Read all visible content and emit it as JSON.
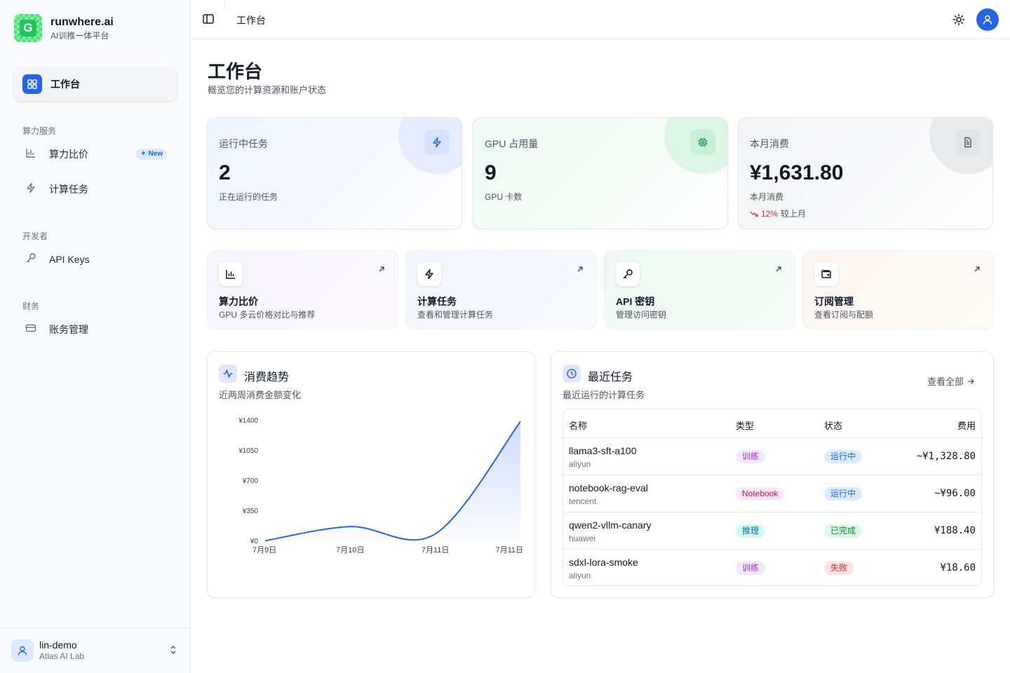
{
  "brand": {
    "name": "runwhere.ai",
    "subtitle": "AI训推一体平台",
    "logo_letter": "G"
  },
  "sidebar": {
    "active_item": {
      "label": "工作台",
      "icon": "grid-icon"
    },
    "sections": [
      {
        "title": "算力服务",
        "items": [
          {
            "label": "算力比价",
            "icon": "bar-chart-icon",
            "badge": "New"
          },
          {
            "label": "计算任务",
            "icon": "lightning-icon"
          }
        ]
      },
      {
        "title": "开发者",
        "items": [
          {
            "label": "API Keys",
            "icon": "key-icon"
          }
        ]
      },
      {
        "title": "财务",
        "items": [
          {
            "label": "账务管理",
            "icon": "credit-card-icon"
          }
        ]
      }
    ],
    "user": {
      "name": "lin-demo",
      "org": "Atlas AI Lab"
    }
  },
  "topbar": {
    "breadcrumb": "工作台"
  },
  "page": {
    "title": "工作台",
    "subtitle": "概览您的计算资源和账户状态"
  },
  "stats": [
    {
      "label": "运行中任务",
      "value": "2",
      "sub": "正在运行的任务",
      "icon": "lightning-icon",
      "accent": "#2563eb"
    },
    {
      "label": "GPU 占用量",
      "value": "9",
      "sub": "GPU 卡数",
      "icon": "chip-icon",
      "accent": "#16a34a"
    },
    {
      "label": "本月消费",
      "value": "¥1,631.80",
      "sub": "本月消费",
      "icon": "document-icon",
      "accent": "#4b5563",
      "trend_value": "12%",
      "trend_label": "较上月",
      "trend_color": "#dc2626"
    }
  ],
  "quick_actions": [
    {
      "title": "算力比价",
      "sub": "GPU 多云价格对比与推荐",
      "icon": "bar-chart-icon"
    },
    {
      "title": "计算任务",
      "sub": "查看和管理计算任务",
      "icon": "lightning-icon"
    },
    {
      "title": "API 密钥",
      "sub": "管理访问密钥",
      "icon": "key-icon"
    },
    {
      "title": "订阅管理",
      "sub": "查看订阅与配额",
      "icon": "wallet-icon"
    }
  ],
  "trend_card": {
    "title": "消费趋势",
    "subtitle": "近两周消费金额变化"
  },
  "chart_data": {
    "type": "area",
    "x": [
      "7月9日",
      "7月10日",
      "7月11日",
      "7月11日"
    ],
    "values": [
      5,
      170,
      85,
      1390
    ],
    "y_ticks": [
      "¥0",
      "¥350",
      "¥700",
      "¥1050",
      "¥1400"
    ],
    "ylim": [
      0,
      1400
    ],
    "grid": false,
    "color": "#2563eb"
  },
  "recent_card": {
    "title": "最近任务",
    "subtitle": "最近运行的计算任务",
    "view_all": "查看全部",
    "columns": [
      "名称",
      "类型",
      "状态",
      "费用"
    ],
    "rows": [
      {
        "name": "llama3-sft-a100",
        "provider": "aliyun",
        "type": "训练",
        "status": "运行中",
        "cost": "~¥1,328.80"
      },
      {
        "name": "notebook-rag-eval",
        "provider": "tencent",
        "type": "Notebook",
        "status": "运行中",
        "cost": "~¥96.00"
      },
      {
        "name": "qwen2-vllm-canary",
        "provider": "huawei",
        "type": "推理",
        "status": "已完成",
        "cost": "¥188.40"
      },
      {
        "name": "sdxl-lora-smoke",
        "provider": "aliyun",
        "type": "训练",
        "status": "失败",
        "cost": "¥18.60"
      }
    ]
  },
  "colors": {
    "primary": "#2563eb",
    "type_train": "#a855f7",
    "type_notebook": "#db2777",
    "type_infer": "#0891b2",
    "status_running": "#2563eb",
    "status_done": "#16a34a",
    "status_failed": "#dc2626"
  }
}
